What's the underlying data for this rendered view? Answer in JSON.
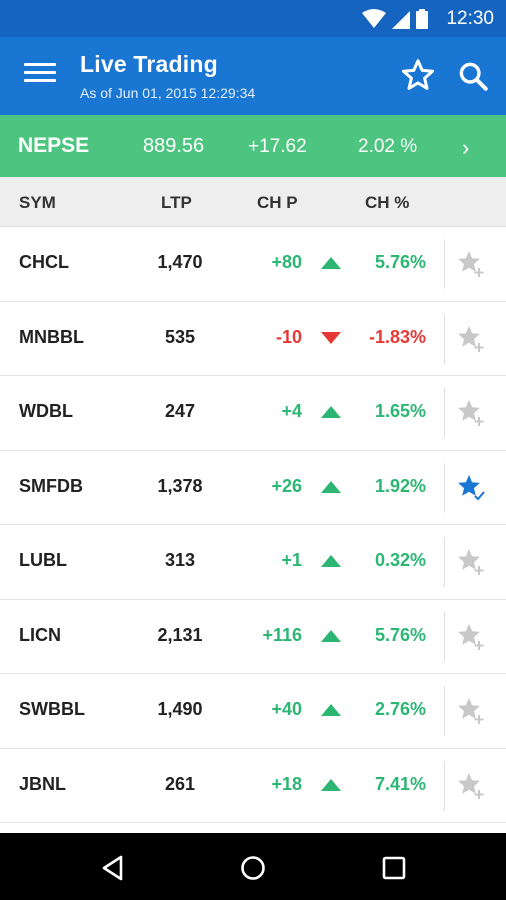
{
  "status_bar": {
    "time": "12:30"
  },
  "app_bar": {
    "title": "Live Trading",
    "subtitle": "As of Jun 01, 2015 12:29:34",
    "icons": [
      "menu-icon",
      "star-outline-icon",
      "search-icon"
    ]
  },
  "index": {
    "name": "NEPSE",
    "value": "889.56",
    "change": "+17.62",
    "change_pct": "2.02 %",
    "arrow": "›"
  },
  "table": {
    "headers": {
      "sym": "SYM",
      "ltp": "LTP",
      "chp": "CH P",
      "chpct": "CH %"
    },
    "rows": [
      {
        "sym": "CHCL",
        "ltp": "1,470",
        "chp": "+80",
        "chpct": "5.76%",
        "dir": "up",
        "fav": false
      },
      {
        "sym": "MNBBL",
        "ltp": "535",
        "chp": "-10",
        "chpct": "-1.83%",
        "dir": "down",
        "fav": false
      },
      {
        "sym": "WDBL",
        "ltp": "247",
        "chp": "+4",
        "chpct": "1.65%",
        "dir": "up",
        "fav": false
      },
      {
        "sym": "SMFDB",
        "ltp": "1,378",
        "chp": "+26",
        "chpct": "1.92%",
        "dir": "up",
        "fav": true
      },
      {
        "sym": "LUBL",
        "ltp": "313",
        "chp": "+1",
        "chpct": "0.32%",
        "dir": "up",
        "fav": false
      },
      {
        "sym": "LICN",
        "ltp": "2,131",
        "chp": "+116",
        "chpct": "5.76%",
        "dir": "up",
        "fav": false
      },
      {
        "sym": "SWBBL",
        "ltp": "1,490",
        "chp": "+40",
        "chpct": "2.76%",
        "dir": "up",
        "fav": false
      },
      {
        "sym": "JBNL",
        "ltp": "261",
        "chp": "+18",
        "chpct": "7.41%",
        "dir": "up",
        "fav": false
      }
    ]
  },
  "colors": {
    "appbar": "#1976d2",
    "statusbar": "#1565c0",
    "index_bar": "#4dc580",
    "up": "#2bb673",
    "down": "#e53935",
    "fav_on": "#1976d2",
    "fav_off": "#c8c8c8"
  },
  "nav_bar": {
    "icons": [
      "back-icon",
      "home-icon",
      "recents-icon"
    ]
  }
}
